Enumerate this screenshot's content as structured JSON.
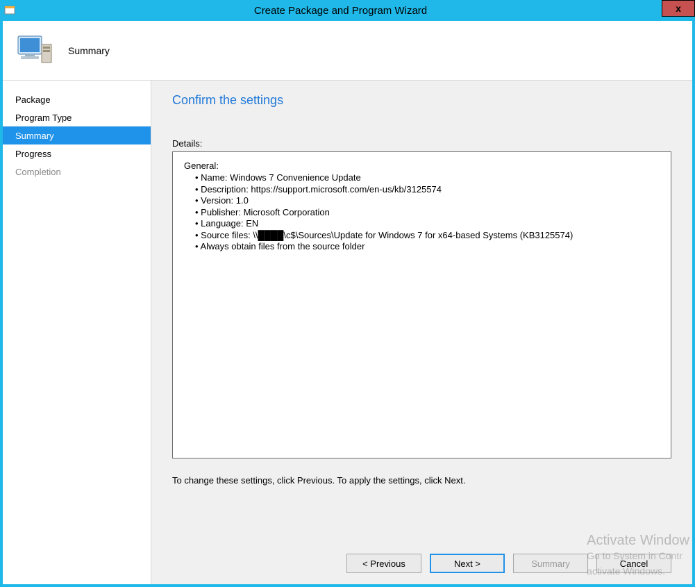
{
  "window": {
    "title": "Create Package and Program Wizard",
    "close_label": "x"
  },
  "header": {
    "title": "Summary"
  },
  "sidebar": {
    "items": [
      {
        "label": "Package",
        "state": "normal"
      },
      {
        "label": "Program Type",
        "state": "normal"
      },
      {
        "label": "Summary",
        "state": "active"
      },
      {
        "label": "Progress",
        "state": "normal"
      },
      {
        "label": "Completion",
        "state": "disabled"
      }
    ]
  },
  "main": {
    "heading": "Confirm the settings",
    "details_label": "Details:",
    "details": {
      "section_heading": "General:",
      "items": [
        "Name: Windows 7 Convenience Update",
        "Description: https://support.microsoft.com/en-us/kb/3125574",
        "Version: 1.0",
        "Publisher: Microsoft Corporation",
        "Language: EN",
        "Source files: \\\\████\\c$\\Sources\\Update for Windows 7 for x64-based Systems (KB3125574)",
        "Always obtain files from the source folder"
      ]
    },
    "hint": "To change these settings, click Previous. To apply the settings, click Next."
  },
  "buttons": {
    "previous": "< Previous",
    "next": "Next >",
    "summary": "Summary",
    "cancel": "Cancel"
  },
  "watermark": {
    "line1": "Activate Window",
    "line2": "Go to System in Contr",
    "line3": "activate Windows."
  }
}
